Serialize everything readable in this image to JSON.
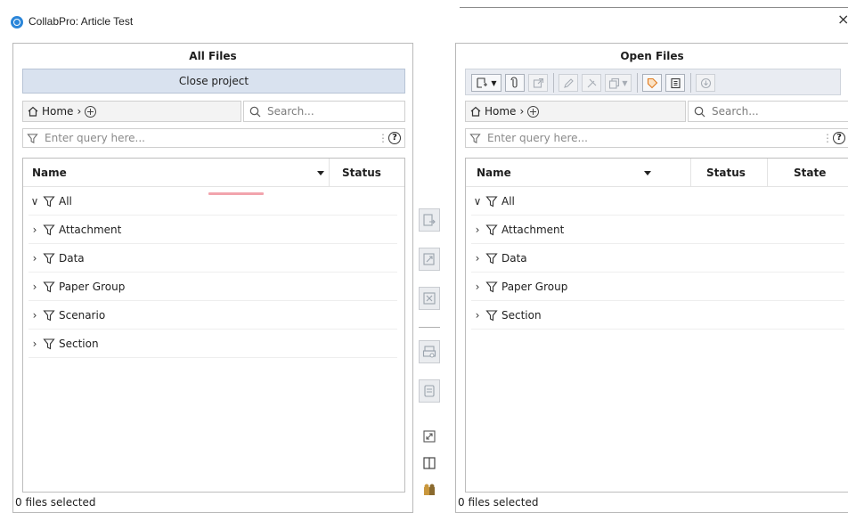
{
  "window": {
    "title": "CollabPro: Article Test",
    "close_glyph": "×"
  },
  "left_panel": {
    "title": "All Files",
    "close_project_label": "Close project",
    "breadcrumb_home": "Home",
    "search_placeholder": "Search...",
    "query_placeholder": "Enter query here...",
    "columns": {
      "name": "Name",
      "status": "Status"
    },
    "rows": [
      {
        "label": "All",
        "expanded": true
      },
      {
        "label": "Attachment",
        "expanded": false
      },
      {
        "label": "Data",
        "expanded": false
      },
      {
        "label": "Paper Group",
        "expanded": false
      },
      {
        "label": "Scenario",
        "expanded": false
      },
      {
        "label": "Section",
        "expanded": false
      }
    ],
    "footer": "0 files selected"
  },
  "right_panel": {
    "title": "Open Files",
    "breadcrumb_home": "Home",
    "search_placeholder": "Search...",
    "query_placeholder": "Enter query here...",
    "columns": {
      "name": "Name",
      "status": "Status",
      "state": "State"
    },
    "rows": [
      {
        "label": "All",
        "expanded": true
      },
      {
        "label": "Attachment",
        "expanded": false
      },
      {
        "label": "Data",
        "expanded": false
      },
      {
        "label": "Paper Group",
        "expanded": false
      },
      {
        "label": "Section",
        "expanded": false
      }
    ],
    "footer": "0 files selected"
  },
  "glyphs": {
    "expanded": "∨",
    "collapsed": "›",
    "chevron_right": "›",
    "help": "?"
  },
  "colors": {
    "accent": "#2b86d9",
    "close_project_bg": "#d9e2ef",
    "toolbar_bg": "#e9ecf2",
    "tag_orange": "#e07a1f",
    "highlight": "#f2a4ad"
  }
}
